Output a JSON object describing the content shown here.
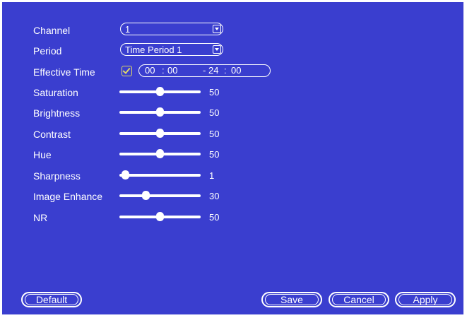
{
  "settings": {
    "channel": {
      "label": "Channel",
      "value": "1"
    },
    "period": {
      "label": "Period",
      "value": "Time Period 1"
    },
    "effective_time": {
      "label": "Effective Time",
      "enabled": true,
      "start_hour": "00",
      "start_minute": "00",
      "separator": "-",
      "end_hour": "24",
      "end_minute": "00"
    },
    "sliders": [
      {
        "label": "Saturation",
        "value": "50",
        "level": 50
      },
      {
        "label": "Brightness",
        "value": "50",
        "level": 50
      },
      {
        "label": "Contrast",
        "value": "50",
        "level": 50
      },
      {
        "label": "Hue",
        "value": "50",
        "level": 50
      },
      {
        "label": "Sharpness",
        "value": "1",
        "level": 1
      },
      {
        "label": "Image Enhance",
        "value": "30",
        "level": 30
      },
      {
        "label": "NR",
        "value": "50",
        "level": 50
      }
    ]
  },
  "buttons": {
    "default_label": "Default",
    "save_label": "Save",
    "cancel_label": "Cancel",
    "apply_label": "Apply"
  },
  "colors": {
    "background": "#3a3ecf",
    "foreground": "#ffffff",
    "checkbox": "#e0d868"
  }
}
